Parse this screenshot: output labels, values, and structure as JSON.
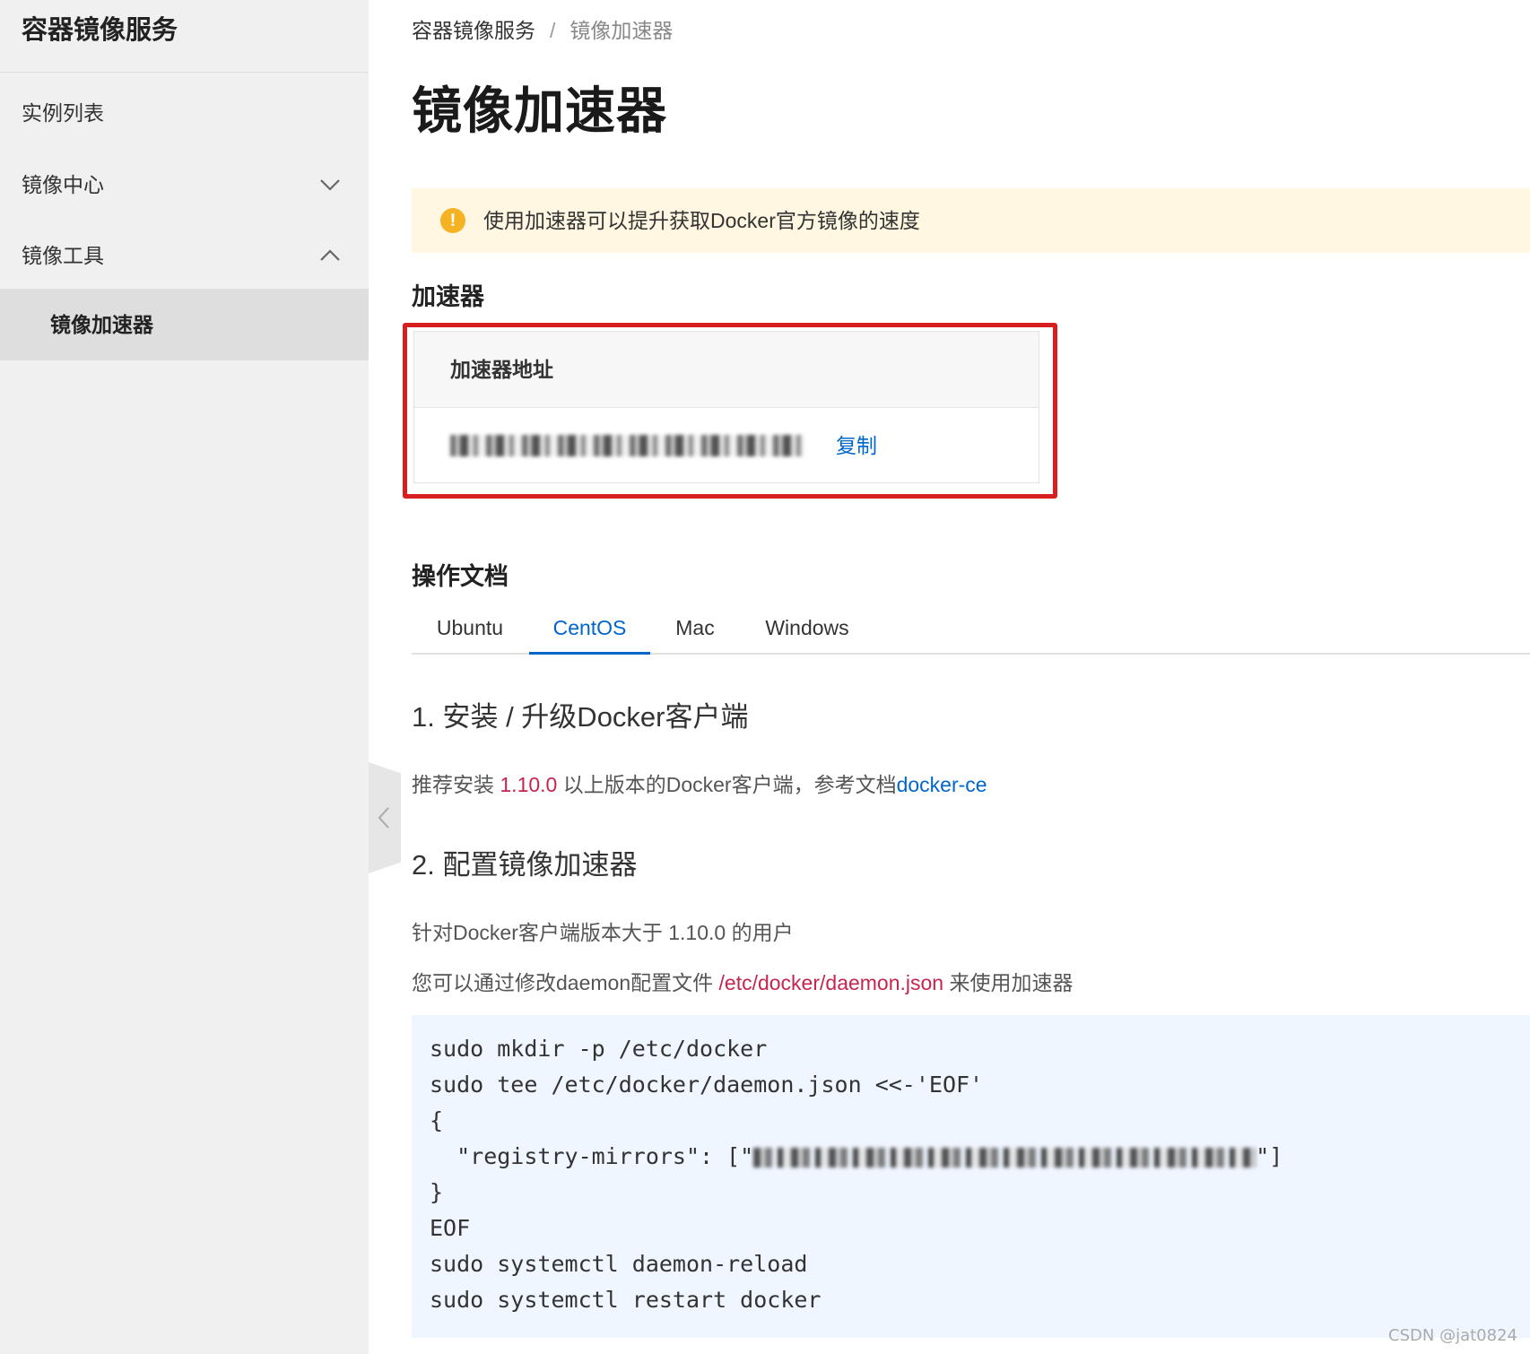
{
  "sidebar": {
    "title": "容器镜像服务",
    "items": [
      {
        "label": "实例列表"
      },
      {
        "label": "镜像中心"
      },
      {
        "label": "镜像工具"
      }
    ],
    "sub_item": {
      "label": "镜像加速器"
    }
  },
  "breadcrumb": {
    "root": "容器镜像服务",
    "separator": "/",
    "current": "镜像加速器"
  },
  "page": {
    "title": "镜像加速器"
  },
  "notice": {
    "icon": "!",
    "text": "使用加速器可以提升获取Docker官方镜像的速度"
  },
  "accelerator": {
    "section_title": "加速器",
    "table_header": "加速器地址",
    "copy_label": "复制"
  },
  "docs": {
    "section_title": "操作文档",
    "tabs": [
      {
        "label": "Ubuntu"
      },
      {
        "label": "CentOS"
      },
      {
        "label": "Mac"
      },
      {
        "label": "Windows"
      }
    ],
    "active_tab": "CentOS",
    "step1": {
      "title": "1. 安装 / 升级Docker客户端",
      "text_prefix": "推荐安装 ",
      "version": "1.10.0",
      "text_middle": " 以上版本的Docker客户端，参考文档",
      "link": "docker-ce"
    },
    "step2": {
      "title": "2. 配置镜像加速器",
      "line1": "针对Docker客户端版本大于 1.10.0 的用户",
      "line2_prefix": "您可以通过修改daemon配置文件 ",
      "line2_path": "/etc/docker/daemon.json",
      "line2_suffix": " 来使用加速器"
    },
    "code": {
      "lines": [
        "sudo mkdir -p /etc/docker",
        "sudo tee /etc/docker/daemon.json <<-'EOF'",
        "{",
        "  \"registry-mirrors\": [\"",
        "}",
        "EOF",
        "sudo systemctl daemon-reload",
        "sudo systemctl restart docker"
      ],
      "mirror_suffix": "\"]"
    }
  },
  "watermark": "CSDN @jat0824",
  "colors": {
    "accent": "#0066cc",
    "highlight_border": "#d62020",
    "warning": "#f5b324",
    "notice_bg": "#fff7e1",
    "code_bg": "#f0f6ff"
  }
}
